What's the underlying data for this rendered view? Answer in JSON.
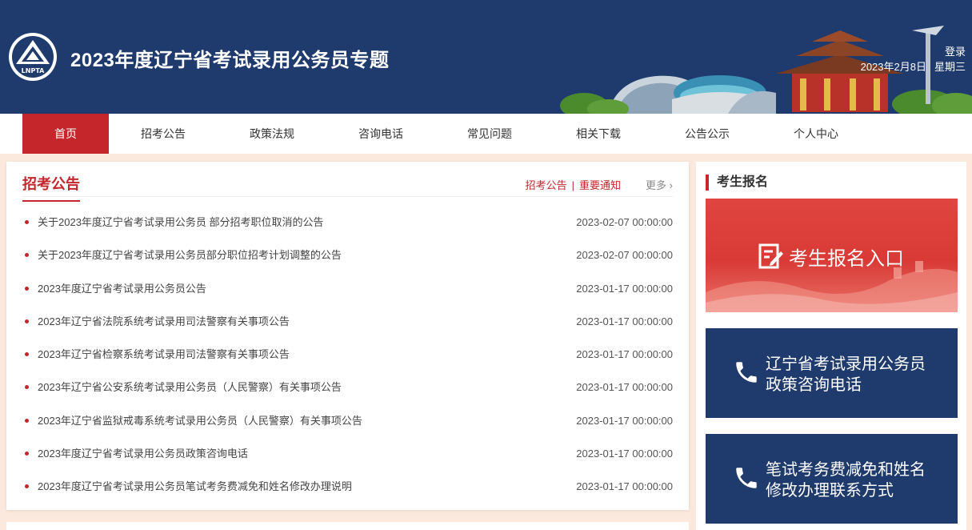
{
  "header": {
    "title": "2023年度辽宁省考试录用公务员专题",
    "logo_text": "LNPTA",
    "login": "登录",
    "date": "2023年2月8日",
    "weekday": "星期三"
  },
  "nav": {
    "items": [
      "首页",
      "招考公告",
      "政策法规",
      "咨询电话",
      "常见问题",
      "相关下载",
      "公告公示",
      "个人中心"
    ]
  },
  "announcements": {
    "title": "招考公告",
    "link1": "招考公告",
    "separator": "|",
    "link2": "重要通知",
    "more": "更多 ›",
    "items": [
      {
        "title": "关于2023年度辽宁省考试录用公务员 部分招考职位取消的公告",
        "date": "2023-02-07 00:00:00"
      },
      {
        "title": "关于2023年度辽宁省考试录用公务员部分职位招考计划调整的公告",
        "date": "2023-02-07 00:00:00"
      },
      {
        "title": "2023年度辽宁省考试录用公务员公告",
        "date": "2023-01-17 00:00:00"
      },
      {
        "title": "2023年辽宁省法院系统考试录用司法警察有关事项公告",
        "date": "2023-01-17 00:00:00"
      },
      {
        "title": "2023年辽宁省检察系统考试录用司法警察有关事项公告",
        "date": "2023-01-17 00:00:00"
      },
      {
        "title": "2023年辽宁省公安系统考试录用公务员（人民警察）有关事项公告",
        "date": "2023-01-17 00:00:00"
      },
      {
        "title": "2023年辽宁省监狱戒毒系统考试录用公务员（人民警察）有关事项公告",
        "date": "2023-01-17 00:00:00"
      },
      {
        "title": "2023年度辽宁省考试录用公务员政策咨询电话",
        "date": "2023-01-17 00:00:00"
      },
      {
        "title": "2023年度辽宁省考试录用公务员笔试考务费减免和姓名修改办理说明",
        "date": "2023-01-17 00:00:00"
      }
    ]
  },
  "sidebar": {
    "title": "考生报名",
    "register_label": "考生报名入口",
    "cards": [
      {
        "line1": "辽宁省考试录用公务员",
        "line2": "政策咨询电话"
      },
      {
        "line1": "笔试考务费减免和姓名",
        "line2": "修改办理联系方式"
      }
    ]
  },
  "colors": {
    "header_bg": "#1f3a6c",
    "accent_red": "#c4262b",
    "page_bg": "#fbe9dd"
  }
}
